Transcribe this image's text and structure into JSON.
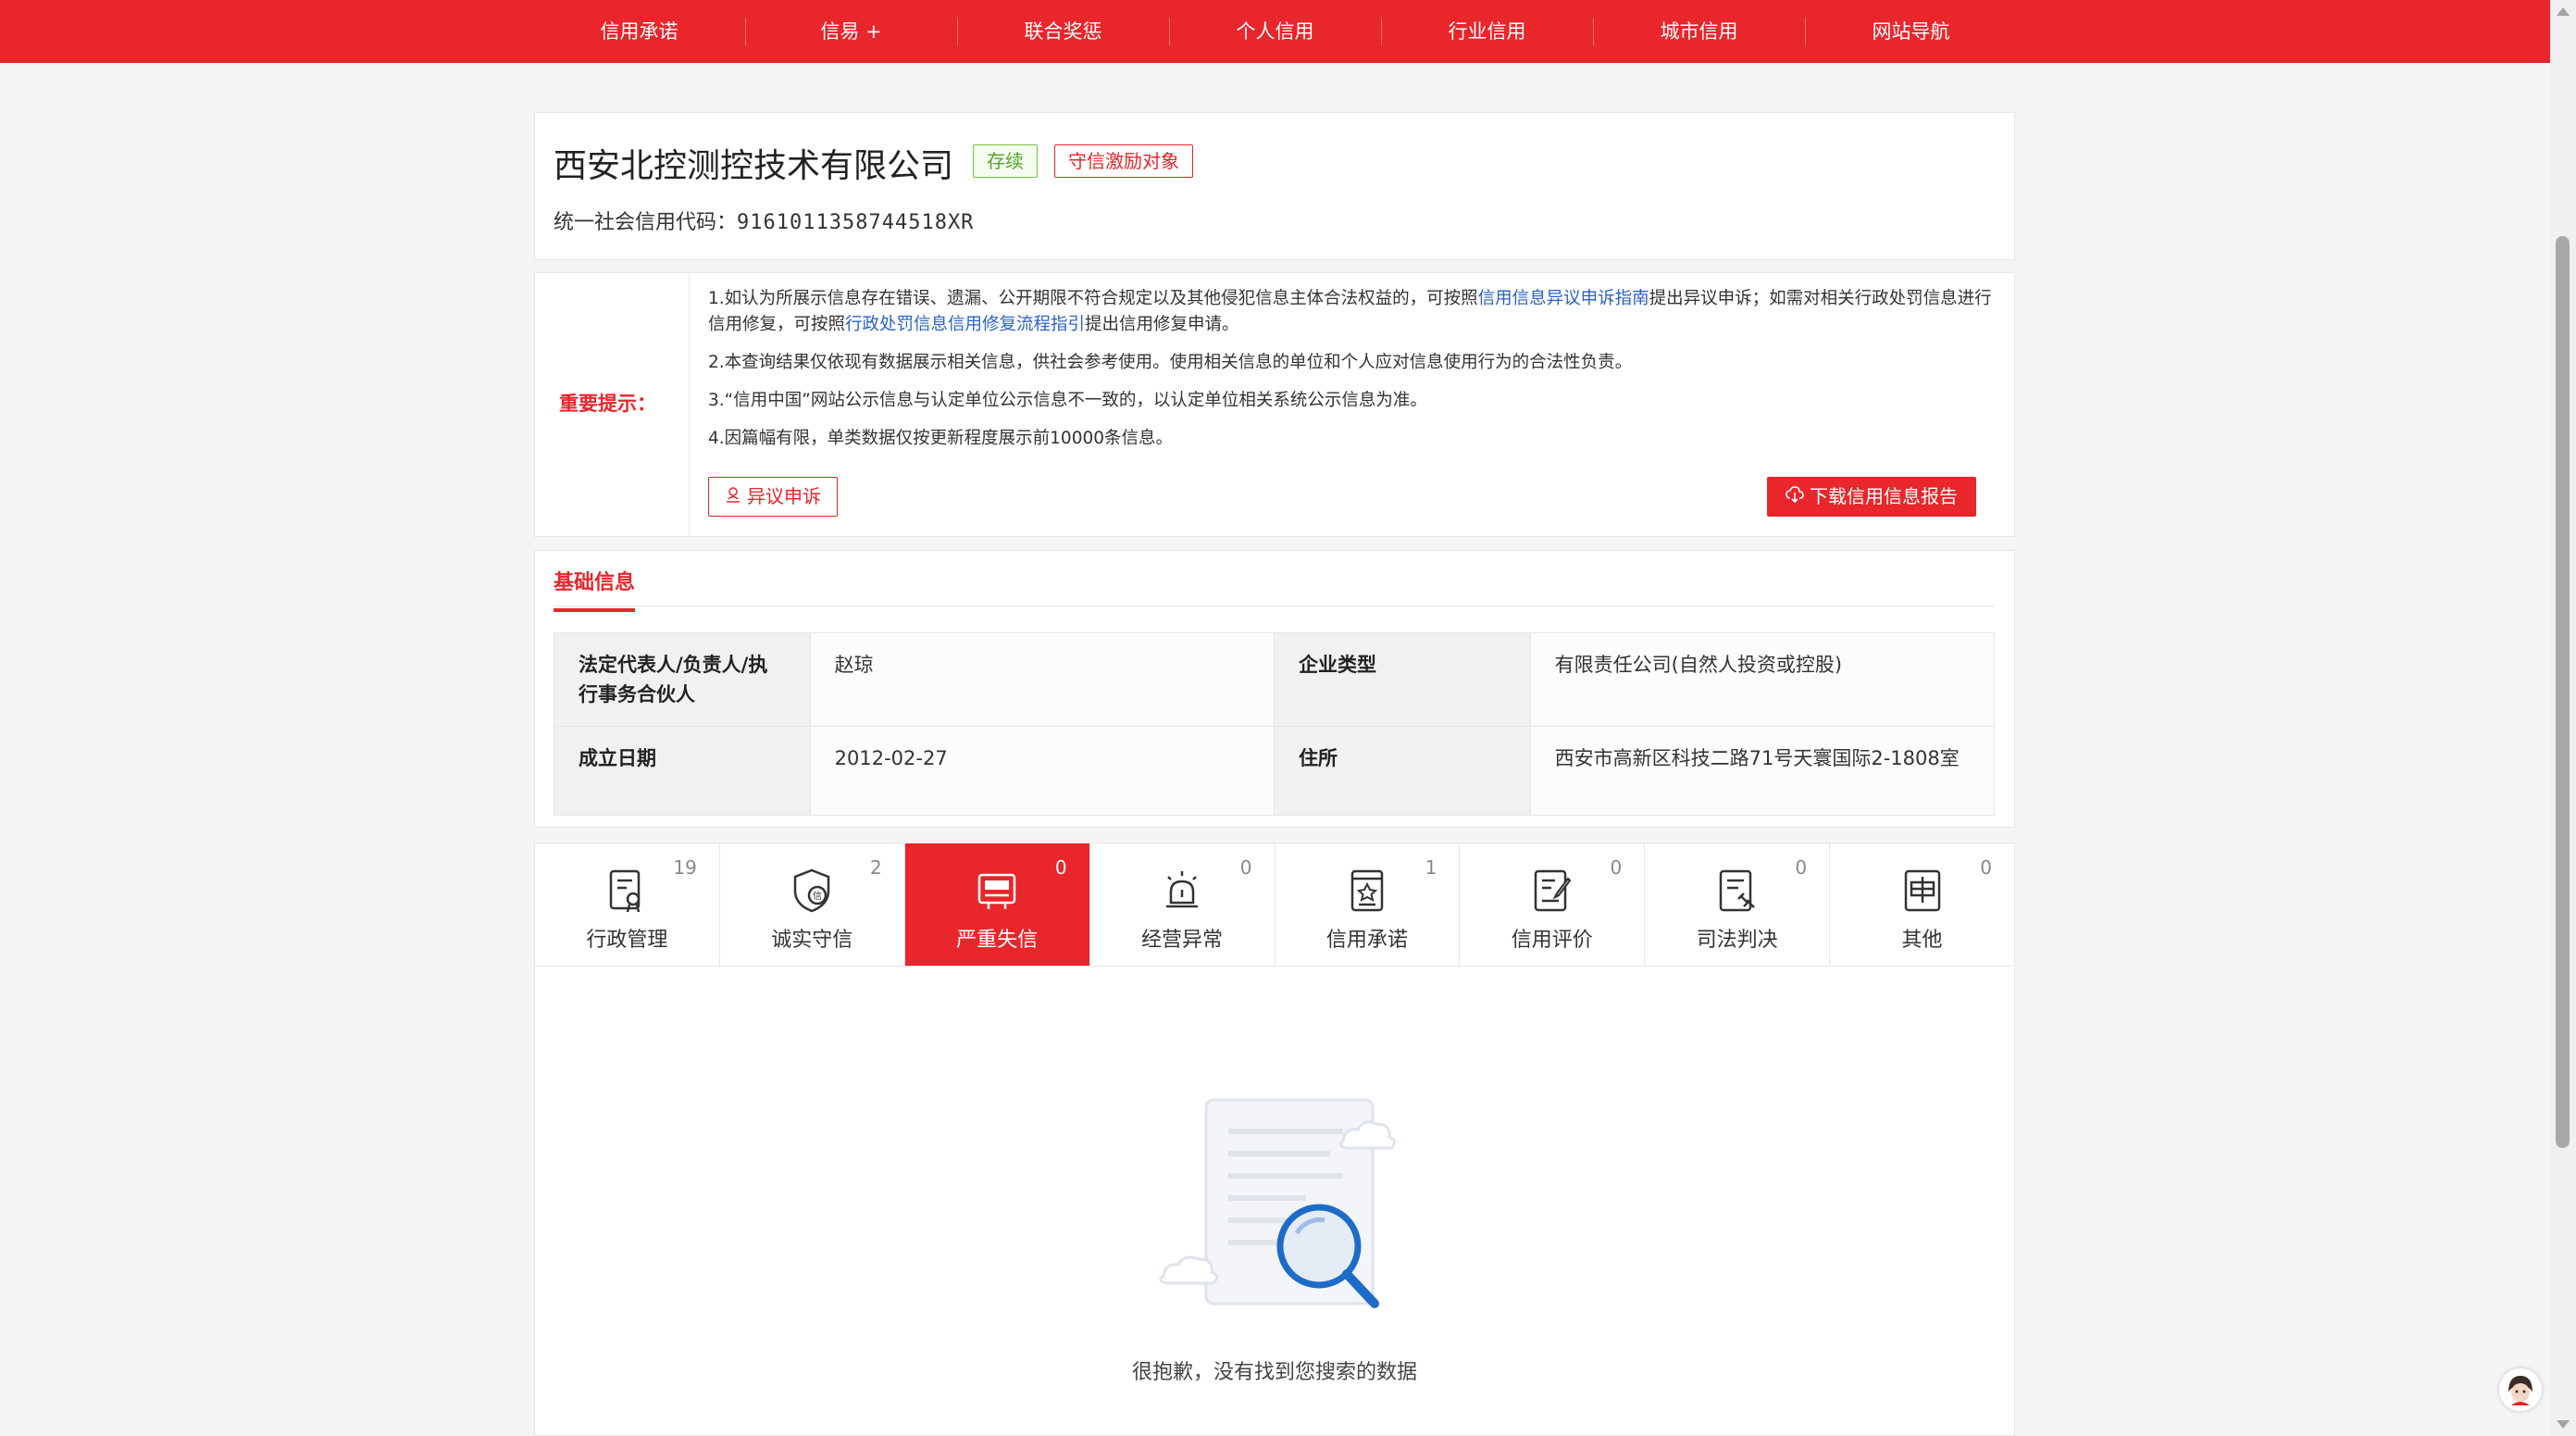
{
  "nav": {
    "items": [
      "信用承诺",
      "信易 +",
      "联合奖惩",
      "个人信用",
      "行业信用",
      "城市信用",
      "网站导航"
    ]
  },
  "company": {
    "name": "西安北控测控技术有限公司",
    "status_badge": "存续",
    "tag_badge": "守信激励对象",
    "code_label": "统一社会信用代码：",
    "code_value": "9161011358744518XR"
  },
  "notice": {
    "label": "重要提示：",
    "line1_a": "1.如认为所展示信息存在错误、遗漏、公开期限不符合规定以及其他侵犯信息主体合法权益的，可按照",
    "line1_link1": "信用信息异议申诉指南",
    "line1_b": "提出异议申诉；如需对相关行政处罚信息进行信用修复，可按照",
    "line1_link2": "行政处罚信息信用修复流程指引",
    "line1_c": "提出信用修复申请。",
    "line2": "2.本查询结果仅依现有数据展示相关信息，供社会参考使用。使用相关信息的单位和个人应对信息使用行为的合法性负责。",
    "line3": "3.“信用中国”网站公示信息与认定单位公示信息不一致的，以认定单位相关系统公示信息为准。",
    "line4": "4.因篇幅有限，单类数据仅按更新程度展示前10000条信息。",
    "objection_button": "异议申诉",
    "download_button": "下载信用信息报告"
  },
  "basic": {
    "tab_title": "基础信息",
    "rows": [
      {
        "k1": "法定代表人/负责人/执行事务合伙人",
        "v1": "赵琼",
        "k2": "企业类型",
        "v2": "有限责任公司(自然人投资或控股)"
      },
      {
        "k1": "成立日期",
        "v1": "2012-02-27",
        "k2": "住所",
        "v2": "西安市高新区科技二路71号天寰国际2-1808室"
      }
    ]
  },
  "tabs": [
    {
      "label": "行政管理",
      "count": "19",
      "icon": "admin-doc-icon"
    },
    {
      "label": "诚实守信",
      "count": "2",
      "icon": "shield-credit-icon"
    },
    {
      "label": "严重失信",
      "count": "0",
      "icon": "dishonest-person-icon"
    },
    {
      "label": "经营异常",
      "count": "0",
      "icon": "alarm-icon"
    },
    {
      "label": "信用承诺",
      "count": "1",
      "icon": "promise-doc-icon"
    },
    {
      "label": "信用评价",
      "count": "0",
      "icon": "rating-edit-icon"
    },
    {
      "label": "司法判决",
      "count": "0",
      "icon": "judgment-doc-icon"
    },
    {
      "label": "其他",
      "count": "0",
      "icon": "other-doc-icon"
    }
  ],
  "empty": {
    "message": "很抱歉，没有找到您搜索的数据"
  },
  "colors": {
    "brand_red": "#e8262b",
    "link_blue": "#2a62c9",
    "status_green": "#52a52b"
  }
}
